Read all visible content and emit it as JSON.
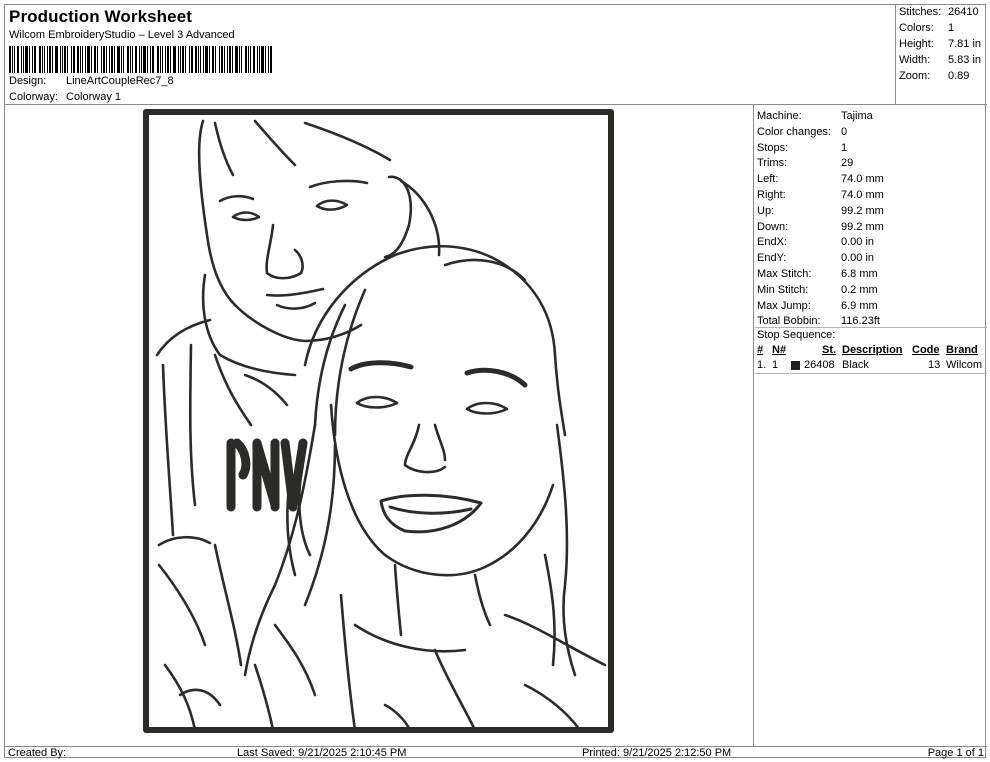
{
  "header": {
    "title": "Production Worksheet",
    "subtitle": "Wilcom EmbroideryStudio – Level 3 Advanced",
    "design_label": "Design:",
    "design_value": "LineArtCoupleRec7_8",
    "colorway_label": "Colorway:",
    "colorway_value": "Colorway 1"
  },
  "stats": {
    "stitches_label": "Stitches:",
    "stitches": "26410",
    "colors_label": "Colors:",
    "colors": "1",
    "height_label": "Height:",
    "height": "7.81 in",
    "width_label": "Width:",
    "width": "5.83 in",
    "zoom_label": "Zoom:",
    "zoom": "0.89"
  },
  "machine_info": [
    {
      "label": "Machine:",
      "value": "Tajima"
    },
    {
      "label": "Color changes:",
      "value": "0"
    },
    {
      "label": "Stops:",
      "value": "1"
    },
    {
      "label": "Trims:",
      "value": "29"
    },
    {
      "label": "Left:",
      "value": "74.0 mm"
    },
    {
      "label": "Right:",
      "value": "74.0 mm"
    },
    {
      "label": "Up:",
      "value": "99.2 mm"
    },
    {
      "label": "Down:",
      "value": "99.2 mm"
    },
    {
      "label": "EndX:",
      "value": "0.00 in"
    },
    {
      "label": "EndY:",
      "value": "0.00 in"
    },
    {
      "label": "Max Stitch:",
      "value": "6.8 mm"
    },
    {
      "label": "Min Stitch:",
      "value": "0.2 mm"
    },
    {
      "label": "Max Jump:",
      "value": "6.9 mm"
    },
    {
      "label": "Total Bobbin:",
      "value": "116.23ft"
    }
  ],
  "stop_sequence": {
    "title": "Stop Sequence:",
    "columns": {
      "num": "#",
      "n": "N#",
      "st": "St.",
      "description": "Description",
      "code": "Code",
      "brand": "Brand"
    },
    "rows": [
      {
        "num": "1.",
        "n": "1",
        "swatch_color": "#1d1d1d",
        "st": "26408",
        "description": "Black",
        "code": "13",
        "brand": "Wilcom"
      }
    ]
  },
  "footer": {
    "created_by": "Created By:",
    "last_saved": "Last Saved: 9/21/2025 2:10:45 PM",
    "printed": "Printed: 9/21/2025 2:12:50 PM",
    "page": "Page 1 of 1"
  },
  "design_preview": {
    "thread_color": "#2b2b28"
  }
}
